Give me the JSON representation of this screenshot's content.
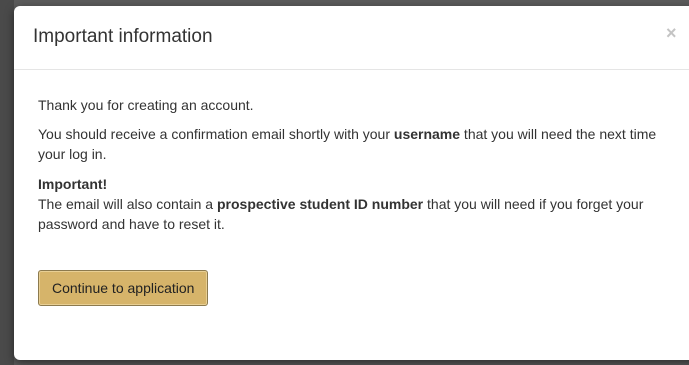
{
  "colors": {
    "backdrop": "#5c5c5c",
    "modal_background": "#ffffff",
    "button_background": "#d6b46a",
    "button_border": "#8c7a4e",
    "text": "#333333",
    "close_icon": "#c4c4c4"
  },
  "modal": {
    "title": "Important information",
    "close_glyph": "×",
    "thank_you": "Thank you for creating an account.",
    "confirmation": {
      "before": "You should receive a confirmation email shortly with your ",
      "bold": "username",
      "after": " that you will need the next time your log in."
    },
    "important": {
      "heading": "Important!",
      "before": "The email will also contain a ",
      "bold": "prospective student ID number",
      "after": " that you will need if you forget your password and have to reset it."
    },
    "continue_label": "Continue to application"
  }
}
